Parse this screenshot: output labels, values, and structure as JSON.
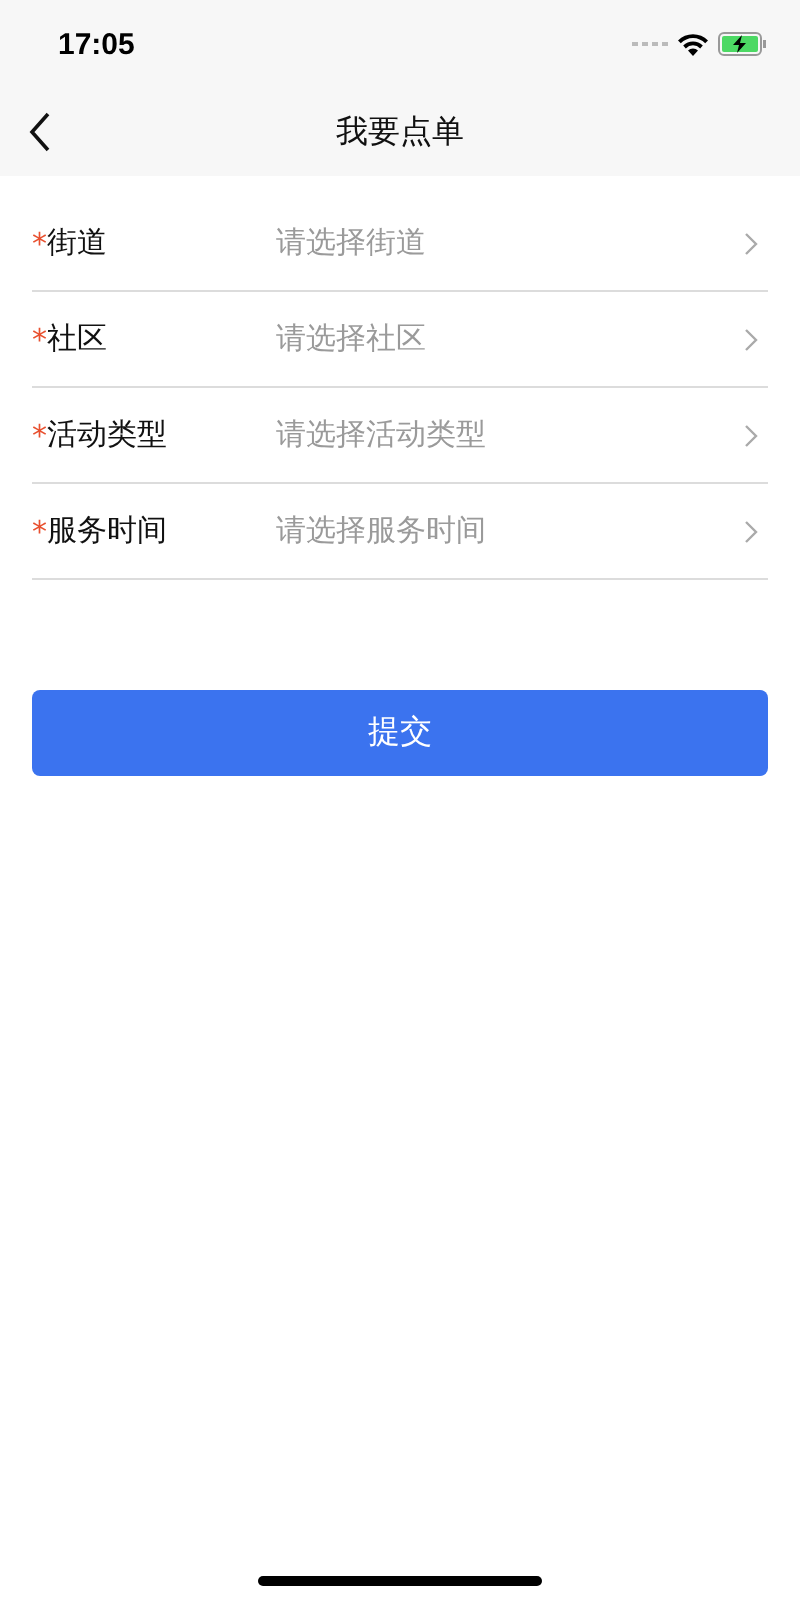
{
  "status_bar": {
    "time": "17:05"
  },
  "nav": {
    "title": "我要点单"
  },
  "fields": [
    {
      "required_mark": "*",
      "label": "街道",
      "placeholder": "请选择街道"
    },
    {
      "required_mark": "*",
      "label": "社区",
      "placeholder": "请选择社区"
    },
    {
      "required_mark": "*",
      "label": "活动类型",
      "placeholder": "请选择活动类型"
    },
    {
      "required_mark": "*",
      "label": "服务时间",
      "placeholder": "请选择服务时间"
    }
  ],
  "submit": "提交"
}
